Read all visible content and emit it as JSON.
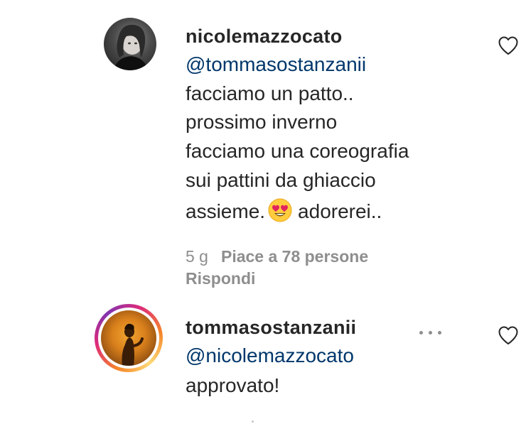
{
  "comments": [
    {
      "username": "nicolemazzocato",
      "mention": "@tommasostanzanii",
      "lines": [
        "facciamo un patto..",
        "prossimo inverno",
        "facciamo una coreografia",
        "sui pattini da ghiaccio"
      ],
      "last_line_before_emoji": "assieme.",
      "emoji": "heart-eyes-emoji",
      "last_line_after_emoji": "adorerei..",
      "time": "5 g",
      "likes": "Piace a 78 persone",
      "reply": "Rispondi",
      "avatar_icon": "profile-photo",
      "like_icon": "heart-outline-icon"
    },
    {
      "username": "tommasostanzanii",
      "mention": "@nicolemazzocato",
      "lines": [
        "approvato!"
      ],
      "avatar_icon": "profile-photo-story-ring",
      "more_icon": "more-options-icon",
      "like_icon": "heart-outline-icon"
    }
  ],
  "colors": {
    "text": "#262626",
    "mention": "#00376b",
    "muted": "#8e8e8e",
    "story_ring_start": "#f58529",
    "story_ring_end": "#dd2a7b"
  }
}
